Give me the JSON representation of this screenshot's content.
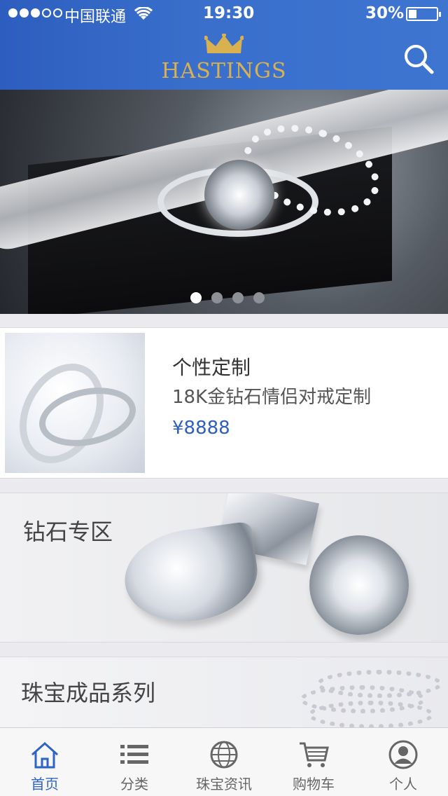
{
  "status": {
    "carrier": "中国联通",
    "time": "19:30",
    "battery_percent_text": "30%",
    "battery_level": 0.3,
    "signal_bars_filled": 3,
    "signal_bars_total": 5
  },
  "header": {
    "brand_name": "HASTINGS",
    "search_icon": "search-icon",
    "brand_color": "#d9b24f",
    "bar_color": "#3366cc"
  },
  "hero": {
    "pager_total": 4,
    "pager_active_index": 0
  },
  "product": {
    "title": "个性定制",
    "subtitle": "18K金钻石情侣对戒定制",
    "price": "¥8888",
    "price_color": "#2e5fbe"
  },
  "sections": {
    "diamond_zone": "钻石专区",
    "finished_series": "珠宝成品系列"
  },
  "tabbar": {
    "items": [
      {
        "label": "首页",
        "icon": "home-icon",
        "active": true
      },
      {
        "label": "分类",
        "icon": "list-icon",
        "active": false
      },
      {
        "label": "珠宝资讯",
        "icon": "globe-icon",
        "active": false
      },
      {
        "label": "购物车",
        "icon": "cart-icon",
        "active": false
      },
      {
        "label": "个人",
        "icon": "user-icon",
        "active": false
      }
    ],
    "active_color": "#2f63c7",
    "inactive_color": "#666666"
  }
}
